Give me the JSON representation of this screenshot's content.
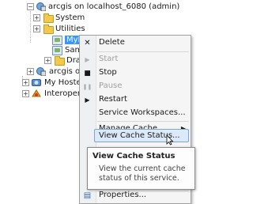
{
  "tree": {
    "server_label": "arcgis on localhost_6080 (admin)",
    "system_label": "System",
    "utilities_label": "Utilities",
    "selected_label": "MyM...",
    "sam_label": "Sam...",
    "draft_label": "Draf...",
    "arcgis_other_label": "arcgis o",
    "hosted_label": "My Hosted",
    "interop_label": "Interoperal",
    "expand_minus": "−",
    "expand_plus": "+"
  },
  "menu": {
    "items": [
      {
        "label": "Delete",
        "icon": "close-icon",
        "glyph": "✕",
        "disabled": false
      },
      {
        "label": "Start",
        "icon": "play-icon",
        "glyph": "▶",
        "disabled": true
      },
      {
        "label": "Stop",
        "icon": "stop-icon",
        "glyph": "■",
        "disabled": false
      },
      {
        "label": "Pause",
        "icon": "pause-icon",
        "glyph": "❚❚",
        "disabled": true
      },
      {
        "label": "Restart",
        "icon": "restart-icon",
        "glyph": "▶",
        "disabled": false
      },
      {
        "label": "Service Workspaces...",
        "icon": "",
        "glyph": "",
        "disabled": false
      },
      {
        "label": "Manage Cache",
        "icon": "",
        "glyph": "",
        "disabled": false,
        "submenu_glyph": "▶"
      },
      {
        "label": "View Cache Status...",
        "icon": "",
        "glyph": "",
        "disabled": false,
        "hover": true
      },
      {
        "label": "Properties...",
        "icon": "properties-icon",
        "glyph": "▤",
        "disabled": false
      }
    ]
  },
  "tooltip": {
    "title": "View Cache Status",
    "body": "View the current cache status of this service."
  },
  "colors": {
    "selection": "#3399ff",
    "hover_fill": "#dce9f8",
    "hover_border": "#7aa7d8"
  }
}
